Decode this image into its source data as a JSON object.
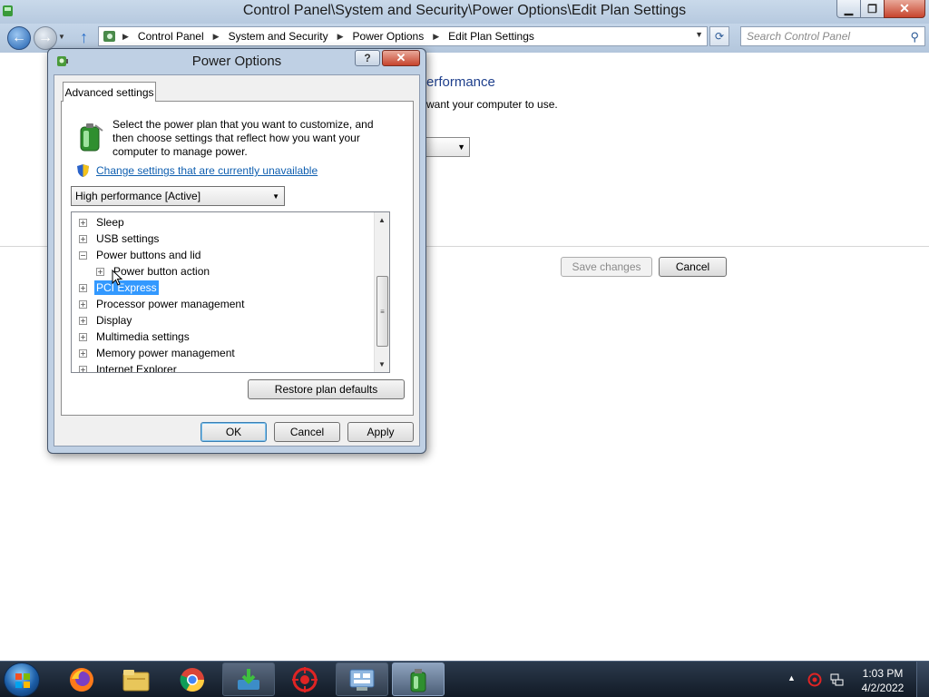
{
  "window": {
    "title": "Control Panel\\System and Security\\Power Options\\Edit Plan Settings"
  },
  "address_bar": {
    "crumbs": [
      "Control Panel",
      "System and Security",
      "Power Options",
      "Edit Plan Settings"
    ]
  },
  "search": {
    "placeholder": "Search Control Panel"
  },
  "background": {
    "heading": "erformance",
    "description": "want your computer to use.",
    "save_label": "Save changes",
    "cancel_label": "Cancel"
  },
  "dialog": {
    "title": "Power Options",
    "help_label": "?",
    "tab_label": "Advanced settings",
    "intro": "Select the power plan that you want to customize, and then choose settings that reflect how you want your computer to manage power.",
    "change_link": "Change settings that are currently unavailable",
    "plan_selected": "High performance [Active]",
    "tree_items": [
      {
        "label": "Sleep",
        "expander": "+",
        "level": 0
      },
      {
        "label": "USB settings",
        "expander": "+",
        "level": 0
      },
      {
        "label": "Power buttons and lid",
        "expander": "−",
        "level": 0
      },
      {
        "label": "Power button action",
        "expander": "+",
        "level": 1
      },
      {
        "label": "PCI Express",
        "expander": "+",
        "level": 0,
        "selected": true
      },
      {
        "label": "Processor power management",
        "expander": "+",
        "level": 0
      },
      {
        "label": "Display",
        "expander": "+",
        "level": 0
      },
      {
        "label": "Multimedia settings",
        "expander": "+",
        "level": 0
      },
      {
        "label": "Memory power management",
        "expander": "+",
        "level": 0
      },
      {
        "label": "Internet Explorer",
        "expander": "+",
        "level": 0
      }
    ],
    "restore_label": "Restore plan defaults",
    "ok_label": "OK",
    "cancel_label": "Cancel",
    "apply_label": "Apply"
  },
  "taskbar": {
    "items": [
      "firefox-icon",
      "file-explorer-icon",
      "chrome-icon",
      "download-manager-icon",
      "security-app-icon",
      "control-panel-icon",
      "power-options-icon"
    ],
    "clock_time": "1:03 PM",
    "clock_date": "4/2/2022"
  },
  "colors": {
    "link": "#0f5fb0",
    "selection": "#3399ff",
    "heading": "#1e3f8c"
  }
}
